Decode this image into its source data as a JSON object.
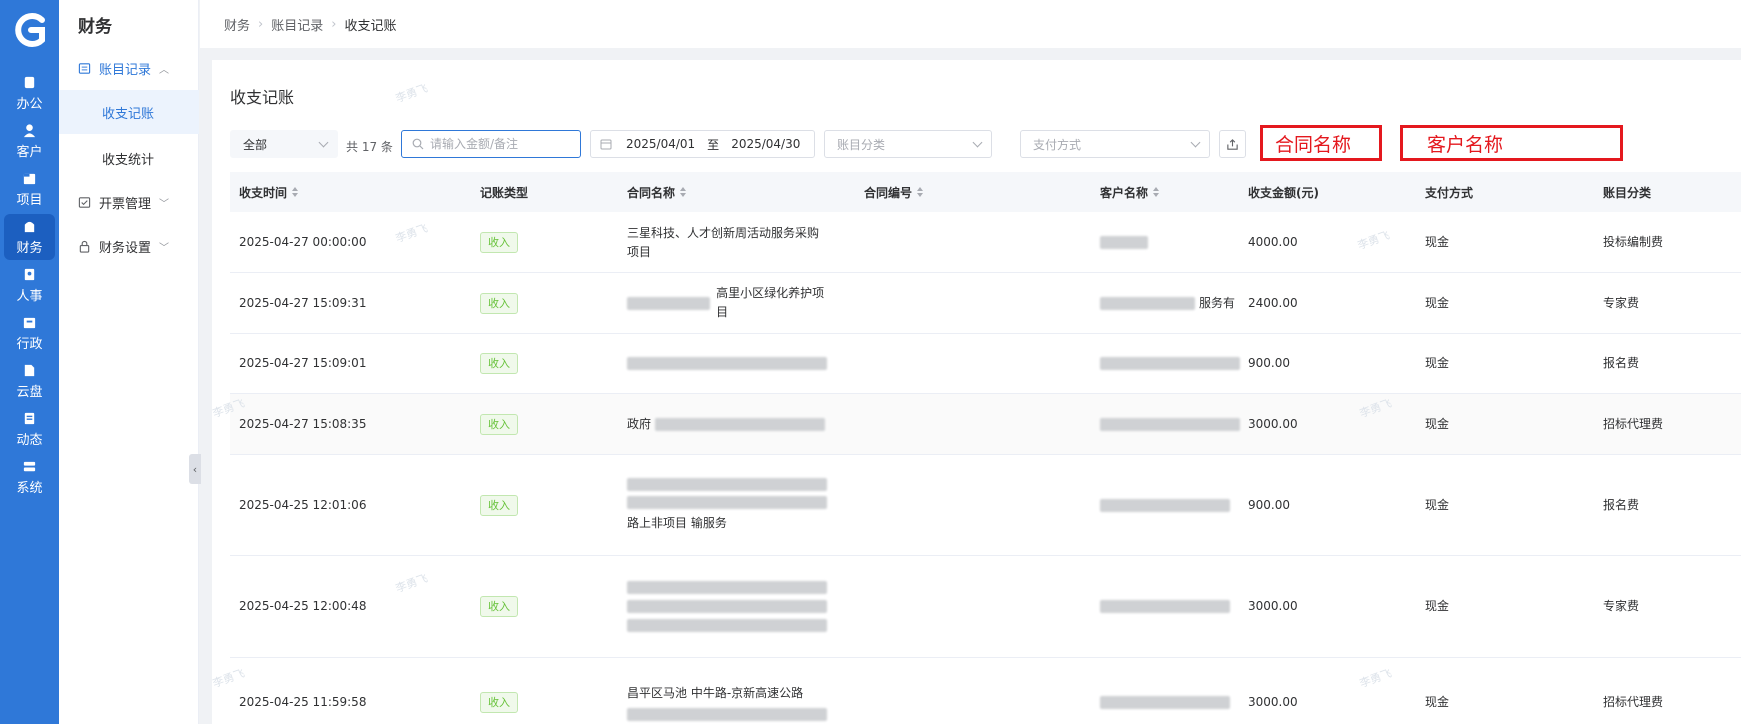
{
  "rail": {
    "items": [
      {
        "label": "办公",
        "icon": "office-icon"
      },
      {
        "label": "客户",
        "icon": "customer-icon"
      },
      {
        "label": "项目",
        "icon": "project-icon"
      },
      {
        "label": "财务",
        "icon": "finance-icon",
        "active": true
      },
      {
        "label": "人事",
        "icon": "hr-icon"
      },
      {
        "label": "行政",
        "icon": "admin-icon"
      },
      {
        "label": "云盘",
        "icon": "cloud-disk-icon"
      },
      {
        "label": "动态",
        "icon": "activity-icon"
      },
      {
        "label": "系统",
        "icon": "system-icon"
      }
    ]
  },
  "sidebar": {
    "title": "财务",
    "groups": [
      {
        "label": "账目记录",
        "open": true,
        "children": [
          "收支记账",
          "收支统计"
        ]
      },
      {
        "label": "开票管理"
      },
      {
        "label": "财务设置"
      }
    ]
  },
  "breadcrumb": [
    "财务",
    "账目记录",
    "收支记账"
  ],
  "page": {
    "title": "收支记账"
  },
  "toolbar": {
    "type_select": "全部",
    "count_text": "共 17 条",
    "search_placeholder": "请输入金额/备注",
    "date_start": "2025/04/01",
    "date_sep": "至",
    "date_end": "2025/04/30",
    "category_placeholder": "账目分类",
    "payment_placeholder": "支付方式"
  },
  "annotations": [
    "合同名称",
    "客户名称"
  ],
  "table": {
    "columns": [
      "收支时间",
      "记账类型",
      "合同名称",
      "合同编号",
      "客户名称",
      "收支金额(元)",
      "支付方式",
      "账目分类"
    ],
    "rows": [
      {
        "time": "2025-04-27 00:00:00",
        "type": "收入",
        "contract": "三星科技、人才创新周活动服务采购项目",
        "customer": "",
        "amount": "4000.00",
        "payment": "现金",
        "category": "投标编制费"
      },
      {
        "time": "2025-04-27 15:09:31",
        "type": "收入",
        "contract": "高里小区绿化养护项目",
        "customer": "服务有",
        "amount": "2400.00",
        "payment": "现金",
        "category": "专家费"
      },
      {
        "time": "2025-04-27 15:09:01",
        "type": "收入",
        "contract": "",
        "customer": "",
        "amount": "900.00",
        "payment": "现金",
        "category": "报名费"
      },
      {
        "time": "2025-04-27 15:08:35",
        "type": "收入",
        "contract": "政府",
        "customer": "",
        "amount": "3000.00",
        "payment": "现金",
        "category": "招标代理费"
      },
      {
        "time": "2025-04-25 12:01:06",
        "type": "收入",
        "contract": "路上非项目 输服务",
        "customer": "",
        "amount": "900.00",
        "payment": "现金",
        "category": "报名费"
      },
      {
        "time": "2025-04-25 12:00:48",
        "type": "收入",
        "contract": "",
        "customer": "",
        "amount": "3000.00",
        "payment": "现金",
        "category": "专家费"
      },
      {
        "time": "2025-04-25 11:59:58",
        "type": "收入",
        "contract": "昌平区马池 中牛路-京新高速公路",
        "customer": "",
        "amount": "3000.00",
        "payment": "现金",
        "category": "招标代理费"
      }
    ]
  },
  "watermark": "李勇飞"
}
